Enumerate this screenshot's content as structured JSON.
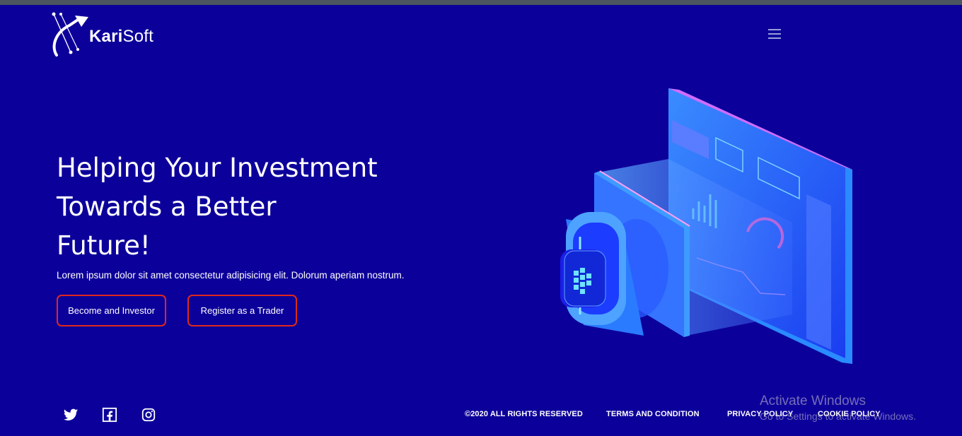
{
  "header": {
    "logo": {
      "bold": "Kari",
      "regular": "Soft"
    },
    "menu_icon": "hamburger-menu-icon"
  },
  "hero": {
    "title_lines": [
      "Helping Your Investment",
      "Towards a Better",
      "Future!"
    ],
    "subtitle": "Lorem ipsum dolor sit amet consectetur adipisicing elit. Dolorum aperiam nostrum.",
    "buttons": {
      "investor": "Become and Investor",
      "trader": "Register as a Trader"
    }
  },
  "footer": {
    "social": [
      "twitter-icon",
      "facebook-icon",
      "instagram-icon"
    ],
    "copyright": "©2020 ALL RIGHTS RESERVED",
    "links": {
      "terms": "TERMS AND CONDITION",
      "privacy": "PRIVACY POLICY",
      "cookie": "COOKIE POLICY"
    }
  },
  "overlay": {
    "title": "Activate Windows",
    "subtitle": "Go to Settings to activate Windows."
  },
  "colors": {
    "background": "#0c009a",
    "button_border": "#e0281c",
    "text": "#ffffff"
  }
}
